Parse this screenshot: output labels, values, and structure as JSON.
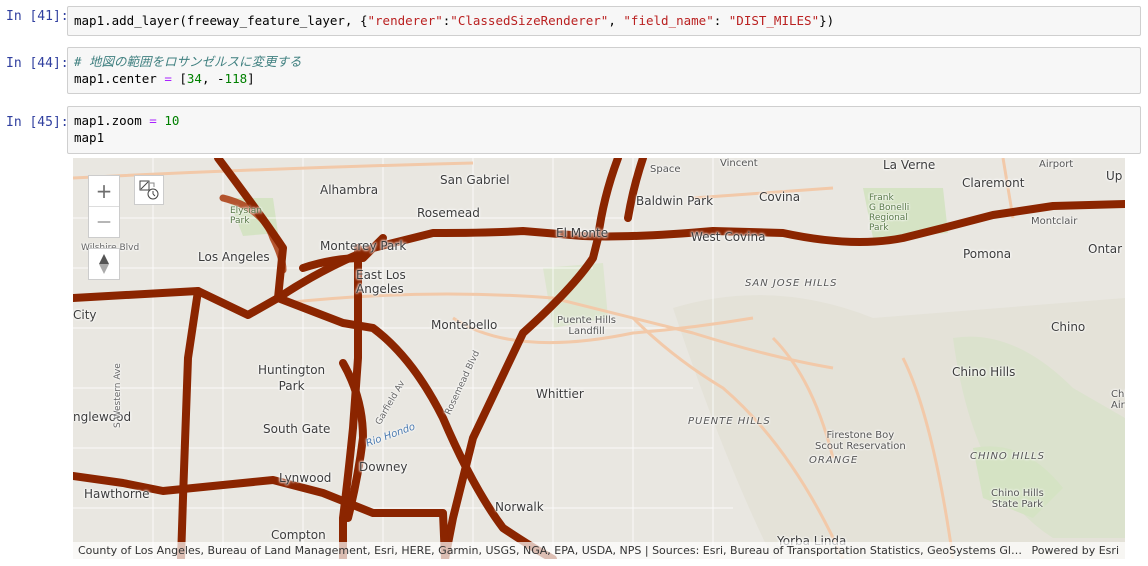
{
  "cells": [
    {
      "prompt": "In [41]:",
      "code_tokens": [
        {
          "t": "map1.add_layer(freeway_feature_layer, {",
          "c": "k-punc"
        },
        {
          "t": "\"renderer\"",
          "c": "k-str"
        },
        {
          "t": ":",
          "c": "k-punc"
        },
        {
          "t": "\"ClassedSizeRenderer\"",
          "c": "k-str"
        },
        {
          "t": ", ",
          "c": "k-punc"
        },
        {
          "t": "\"field_name\"",
          "c": "k-str"
        },
        {
          "t": ": ",
          "c": "k-punc"
        },
        {
          "t": "\"DIST_MILES\"",
          "c": "k-str"
        },
        {
          "t": "})",
          "c": "k-punc"
        }
      ]
    },
    {
      "prompt": "In [44]:",
      "comment": "# 地図の範囲をロサンゼルスに変更する",
      "line2_a": "map1.center ",
      "line2_op": "=",
      "line2_b": " [",
      "line2_n1": "34",
      "line2_c": ", -",
      "line2_n2": "118",
      "line2_d": "]"
    },
    {
      "prompt": "In [45]:",
      "line1_a": "map1.zoom ",
      "line1_op": "=",
      "line1_n": " 10",
      "line2": "map1"
    }
  ],
  "map": {
    "zoom_in_label": "+",
    "zoom_out_label": "—",
    "attribution": "County of Los Angeles, Bureau of Land Management, Esri, HERE, Garmin, USGS, NGA, EPA, USDA, NPS | Sources: Esri, Bureau of Transportation Statistics, GeoSystems Glob…",
    "powered_by": "Powered by Esri",
    "colors": {
      "freeway": "#8b2500",
      "freeway_light": "#b3542e",
      "road": "#f2c9a9"
    },
    "labels": {
      "alhambra": "Alhambra",
      "san_gabriel": "San Gabriel",
      "vincent": "Vincent",
      "la_verne": "La Verne",
      "airport": "Airport",
      "claremont": "Claremont",
      "upland": "Up",
      "rosemead": "Rosemead",
      "baldwin_park": "Baldwin Park",
      "covina": "Covina",
      "elysian_park": "Elysian\nPark",
      "frank_bonelli": "Frank\nG Bonelli\nRegional\nPark",
      "montclair": "Montclair",
      "wilshire": "Wilshire Blvd",
      "monterey_park": "Monterey Park",
      "el_monte": "El Monte",
      "west_covina": "West Covina",
      "los_angeles": "Los Angeles",
      "east_la": "East Los\nAngeles",
      "pomona": "Pomona",
      "ontario": "Ontar",
      "san_jose_hills": "SAN JOSE HILLS",
      "city": "City",
      "montebello": "Montebello",
      "puente_landfill": "Puente Hills\nLandfill",
      "chino": "Chino",
      "huntington_park": "Huntington\nPark",
      "chino_hills": "Chino Hills",
      "whittier": "Whittier",
      "inglewood": "nglewood",
      "s_western": "S Western Ave",
      "garfield": "Garfield Av",
      "rosemead_blvd": "Rosemead Blvd",
      "puente_hills": "PUENTE HILLS",
      "south_gate": "South Gate",
      "rio_hondo": "Rio Hondo",
      "firestone": "Firestone Boy\nScout Reservation",
      "orange": "ORANGE",
      "chino_hills_area": "CHINO HILLS",
      "downey": "Downey",
      "lynwood": "Lynwood",
      "hawthorne": "Hawthorne",
      "norwalk": "Norwalk",
      "chino_hills_sp": "Chino Hills\nState Park",
      "compton": "Compton",
      "yorba_linda": "Yorba Linda",
      "space": "Space",
      "chi_air": "Chi\nAir"
    }
  }
}
